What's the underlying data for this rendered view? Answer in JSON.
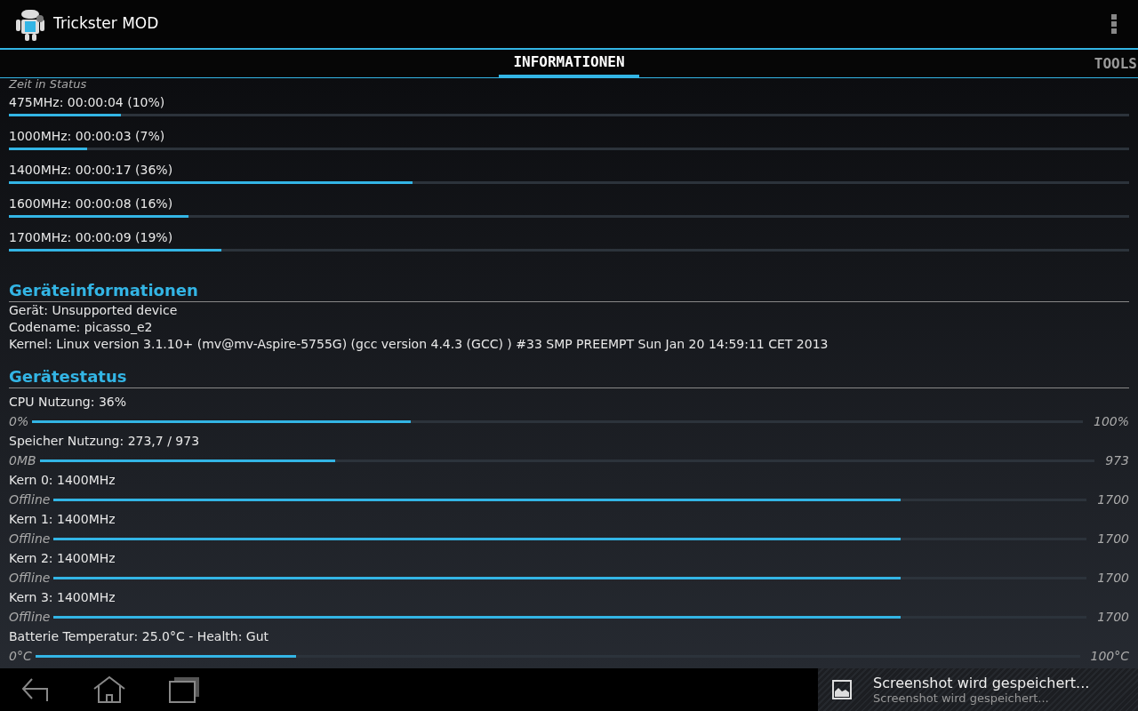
{
  "app_bar": {
    "title": "Trickster MOD"
  },
  "tabs": [
    {
      "label": "INFORMATIONEN",
      "selected": true
    },
    {
      "label": "TOOLS",
      "selected": false
    }
  ],
  "time_in_state": {
    "heading": "Zeit in Status",
    "rows": [
      {
        "label": "475MHz: 00:00:04 (10%)",
        "level": 0.1
      },
      {
        "label": "1000MHz: 00:00:03 (7%)",
        "level": 0.07
      },
      {
        "label": "1400MHz: 00:00:17 (36%)",
        "level": 0.36
      },
      {
        "label": "1600MHz: 00:00:08 (16%)",
        "level": 0.16
      },
      {
        "label": "1700MHz: 00:00:09 (19%)",
        "level": 0.19
      }
    ]
  },
  "device_info": {
    "heading": "Geräteinformationen",
    "lines": [
      "Gerät: Unsupported device",
      "Codename: picasso_e2",
      "Kernel: Linux version 3.1.10+ (mv@mv-Aspire-5755G) (gcc version 4.4.3 (GCC) ) #33 SMP PREEMPT Sun Jan 20 14:59:11 CET 2013"
    ]
  },
  "device_status": {
    "heading": "Gerätestatus",
    "rows": [
      {
        "label": "CPU Nutzung: 36%",
        "min": "0%",
        "max": "100%",
        "level": 0.36
      },
      {
        "label": "Speicher Nutzung: 273,7 / 973",
        "min": "0MB",
        "max": "973",
        "level": 0.28
      },
      {
        "label": "Kern 0: 1400MHz",
        "min": "Offline",
        "max": "1700",
        "level": 0.82
      },
      {
        "label": "Kern 1: 1400MHz",
        "min": "Offline",
        "max": "1700",
        "level": 0.82
      },
      {
        "label": "Kern 2: 1400MHz",
        "min": "Offline",
        "max": "1700",
        "level": 0.82
      },
      {
        "label": "Kern 3: 1400MHz",
        "min": "Offline",
        "max": "1700",
        "level": 0.82
      },
      {
        "label": "Batterie Temperatur: 25.0°C - Health: Gut",
        "min": "0°C",
        "max": "100°C",
        "level": 0.25
      }
    ]
  },
  "notification": {
    "title": "Screenshot wird gespeichert...",
    "text": "Screenshot wird gespeichert..."
  }
}
